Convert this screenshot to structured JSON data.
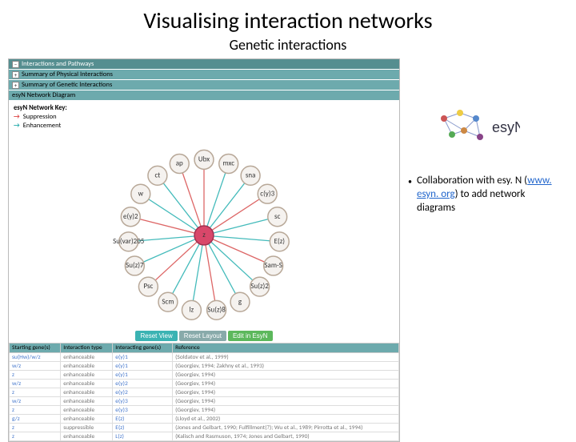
{
  "title": "Visualising interaction networks",
  "subtitle": "Genetic interactions",
  "headers": {
    "h1": "Interactions and Pathways",
    "h2": "Summary of Physical Interactions",
    "h3": "Summary of Genetic Interactions",
    "h4": "esyN Network Diagram"
  },
  "key": {
    "title": "esyN Network Key:",
    "sup": "Suppression",
    "enh": "Enhancement"
  },
  "nodes": {
    "center": "z",
    "ring": [
      "Ubx",
      "mxc",
      "sna",
      "c(y)3",
      "sc",
      "E(z)",
      "Sam-S",
      "Su(z)2",
      "g",
      "Su(z)8",
      "lz",
      "Scm",
      "Psc",
      "Su(z)7",
      "Su(var)205",
      "e(y)2",
      "w",
      "ct",
      "ap"
    ]
  },
  "buttons": {
    "b1": "Reset View",
    "b2": "Reset Layout",
    "b3": "Edit in EsyN"
  },
  "table": {
    "cols": [
      "Starting gene(s)",
      "Interaction type",
      "Interacting gene(s)",
      "Reference"
    ],
    "rows": [
      [
        "su(Hw)/w/z",
        "enhanceable",
        "e(y)1",
        "(Soldatov et al., 1999)"
      ],
      [
        "w/z",
        "enhanceable",
        "e(y)1",
        "(Georgiev, 1994; Zakhny et al., 1993)"
      ],
      [
        "z",
        "enhanceable",
        "e(y)1",
        "(Georgiev, 1994)"
      ],
      [
        "w/z",
        "enhanceable",
        "e(y)2",
        "(Georgiev, 1994)"
      ],
      [
        "z",
        "enhanceable",
        "e(y)2",
        "(Georgiev, 1994)"
      ],
      [
        "w/z",
        "enhanceable",
        "e(y)3",
        "(Georgiev, 1994)"
      ],
      [
        "z",
        "enhanceable",
        "e(y)3",
        "(Georgiev, 1994)"
      ],
      [
        "g/z",
        "enhanceable",
        "E(z)",
        "(Lloyd et al., 2002)"
      ],
      [
        "z",
        "suppressible",
        "E(z)",
        "(Jones and Gelbart, 1990; Fulfillment(?); Wu et al., 1989; Pirrotta et al., 1994)"
      ],
      [
        "z",
        "enhanceable",
        "L(z)",
        "(Kalisch and Rasmuson, 1974; Jones and Gelbart, 1990)"
      ]
    ]
  },
  "bullet": {
    "pre": "Collaboration with esy. N (",
    "link": "www. esyn. org",
    "post": ") to add network diagrams"
  },
  "logo_text": "esyN"
}
